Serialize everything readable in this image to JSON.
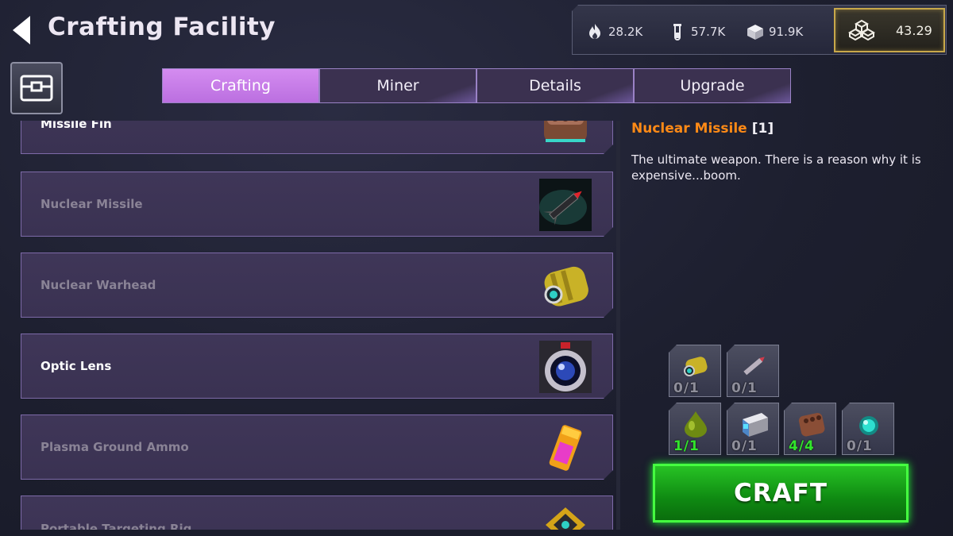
{
  "header": {
    "title": "Crafting Facility",
    "resources": [
      {
        "icon": "flame-icon",
        "value": "28.2K"
      },
      {
        "icon": "vial-icon",
        "value": "57.7K"
      },
      {
        "icon": "ore-cube-icon",
        "value": "91.9K"
      }
    ],
    "premium": {
      "icon": "crystal-cubes-icon",
      "value": "43.29"
    }
  },
  "tabs": [
    {
      "label": "Crafting",
      "active": true
    },
    {
      "label": "Miner",
      "active": false
    },
    {
      "label": "Details",
      "active": false
    },
    {
      "label": "Upgrade",
      "active": false
    }
  ],
  "recipes": [
    {
      "name": "Missile Fin",
      "available": true,
      "icon": "missile-fin-icon"
    },
    {
      "name": "Nuclear Missile",
      "available": false,
      "icon": "nuclear-missile-icon"
    },
    {
      "name": "Nuclear Warhead",
      "available": false,
      "icon": "nuclear-warhead-icon"
    },
    {
      "name": "Optic Lens",
      "available": true,
      "icon": "optic-lens-icon"
    },
    {
      "name": "Plasma Ground Ammo",
      "available": false,
      "icon": "plasma-ammo-icon"
    },
    {
      "name": "Portable Targeting Rig",
      "available": false,
      "icon": "targeting-rig-icon"
    }
  ],
  "detail": {
    "name": "Nuclear Missile",
    "count": "[1]",
    "description": "The ultimate weapon. There is a reason why it is expensive...boom."
  },
  "ingredients": [
    {
      "icon": "warhead-ingredient-icon",
      "count": "0/1",
      "met": false
    },
    {
      "icon": "missile-body-ingredient-icon",
      "count": "0/1",
      "met": false
    },
    {
      "icon": "green-gel-ingredient-icon",
      "count": "1/1",
      "met": true
    },
    {
      "icon": "circuit-box-ingredient-icon",
      "count": "0/1",
      "met": false
    },
    {
      "icon": "missile-fin-ingredient-icon",
      "count": "4/4",
      "met": true
    },
    {
      "icon": "teal-orb-ingredient-icon",
      "count": "0/1",
      "met": false
    }
  ],
  "craft_label": "CRAFT",
  "colors": {
    "accent_tab": "#c97ee9",
    "item_name_highlight": "#ff8a16",
    "ok_count": "#32e42c",
    "craft_green": "#1fa81f",
    "gold_border": "#c8a84a"
  }
}
